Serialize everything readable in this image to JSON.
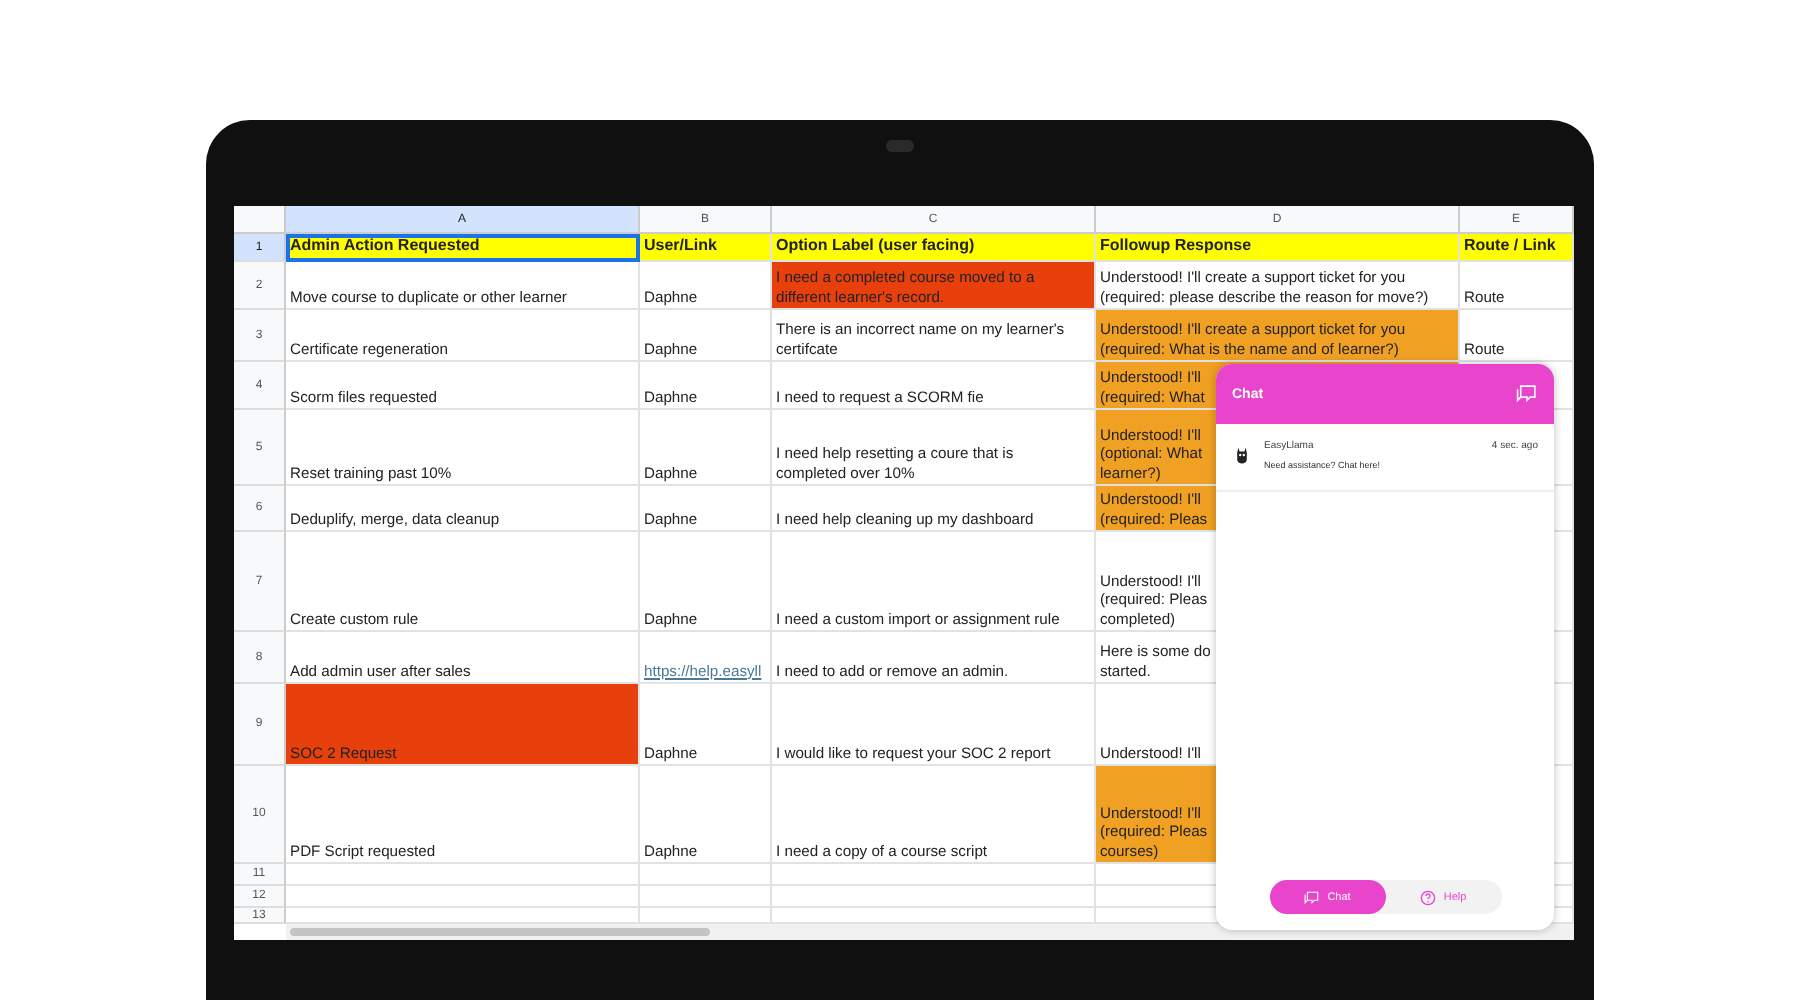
{
  "sheet": {
    "columns": [
      {
        "label": "A",
        "selected": true
      },
      {
        "label": "B",
        "selected": false
      },
      {
        "label": "C",
        "selected": false
      },
      {
        "label": "D",
        "selected": false
      },
      {
        "label": "E",
        "selected": false
      }
    ],
    "rows": [
      {
        "number": "1",
        "selected": true,
        "kind": "header",
        "cells": [
          {
            "lines": [
              "Admin Action Requested"
            ]
          },
          {
            "lines": [
              "User/Link"
            ]
          },
          {
            "lines": [
              "Option Label (user facing)"
            ]
          },
          {
            "lines": [
              "Followup Response"
            ]
          },
          {
            "lines": [
              "Route / Link"
            ]
          }
        ]
      },
      {
        "number": "2",
        "selected": false,
        "kind": "data",
        "cells": [
          {
            "lines": [
              "Move course to duplicate or other learner"
            ]
          },
          {
            "lines": [
              "Daphne"
            ]
          },
          {
            "lines": [
              "I need a completed course moved to a",
              "different learner's record."
            ],
            "color": "#e8400c"
          },
          {
            "lines": [
              "Understood! I'll create a support ticket for you",
              "(required: please describe the reason for move?)"
            ]
          },
          {
            "lines": [
              "Route"
            ]
          }
        ]
      },
      {
        "number": "3",
        "selected": false,
        "kind": "data",
        "cells": [
          {
            "lines": [
              "Certificate regeneration"
            ]
          },
          {
            "lines": [
              "Daphne"
            ]
          },
          {
            "lines": [
              "There is an incorrect name on my learner's",
              "certifcate"
            ]
          },
          {
            "lines": [
              "Understood! I'll create a support ticket for you",
              "(required: What is the name and of learner?)"
            ],
            "color": "#f0a023"
          },
          {
            "lines": [
              "Route"
            ]
          }
        ]
      },
      {
        "number": "4",
        "selected": false,
        "kind": "data",
        "cells": [
          {
            "lines": [
              "Scorm files requested"
            ]
          },
          {
            "lines": [
              "Daphne"
            ]
          },
          {
            "lines": [
              "I need to request a SCORM fie"
            ]
          },
          {
            "lines": [
              "Understood! I'll",
              "(required: What"
            ],
            "color": "#f0a023"
          }
        ]
      },
      {
        "number": "5",
        "selected": false,
        "kind": "data",
        "cells": [
          {
            "lines": [
              "Reset training past 10%"
            ]
          },
          {
            "lines": [
              "Daphne"
            ]
          },
          {
            "lines": [
              "I need help resetting a coure that is",
              "completed over 10%"
            ]
          },
          {
            "lines": [
              "Understood! I'll",
              "(optional: What",
              "learner?)"
            ],
            "color": "#f0a023"
          }
        ]
      },
      {
        "number": "6",
        "selected": false,
        "kind": "data",
        "cells": [
          {
            "lines": [
              "Deduplify, merge, data cleanup"
            ]
          },
          {
            "lines": [
              "Daphne"
            ]
          },
          {
            "lines": [
              "I need help cleaning up my dashboard"
            ]
          },
          {
            "lines": [
              "Understood! I'll",
              "(required: Pleas"
            ],
            "color": "#f0a023"
          }
        ]
      },
      {
        "number": "7",
        "selected": false,
        "kind": "data",
        "cells": [
          {
            "lines": [
              "Create custom rule"
            ]
          },
          {
            "lines": [
              "Daphne"
            ]
          },
          {
            "lines": [
              "I need a custom import or assignment rule"
            ]
          },
          {
            "lines": [
              "Understood! I'll",
              "(required: Pleas",
              "completed)"
            ]
          }
        ]
      },
      {
        "number": "8",
        "selected": false,
        "kind": "data",
        "cells": [
          {
            "lines": [
              "Add admin user after sales"
            ]
          },
          {
            "lines": [
              "https://help.easyll"
            ],
            "kind": "link"
          },
          {
            "lines": [
              "I need to add or remove an admin."
            ]
          },
          {
            "lines": [
              "Here is some do",
              "started."
            ]
          }
        ]
      },
      {
        "number": "9",
        "selected": false,
        "kind": "data",
        "cells": [
          {
            "lines": [
              "SOC 2 Request"
            ],
            "color": "#e8400c"
          },
          {
            "lines": [
              "Daphne"
            ]
          },
          {
            "lines": [
              "I would like to request your SOC 2 report"
            ]
          },
          {
            "lines": [
              "Understood! I'll"
            ]
          }
        ]
      },
      {
        "number": "10",
        "selected": false,
        "kind": "data",
        "cells": [
          {
            "lines": [
              "PDF Script requested"
            ]
          },
          {
            "lines": [
              "Daphne"
            ]
          },
          {
            "lines": [
              "I need a copy of a course script"
            ]
          },
          {
            "lines": [
              "Understood! I'll",
              "(required: Pleas",
              "courses)"
            ],
            "color": "#f0a023"
          }
        ]
      },
      {
        "number": "11",
        "selected": false,
        "kind": "data",
        "cells": []
      },
      {
        "number": "12",
        "selected": false,
        "kind": "data",
        "cells": []
      },
      {
        "number": "13",
        "selected": false,
        "kind": "data",
        "cells": []
      }
    ]
  },
  "chat": {
    "title": "Chat",
    "messages": [
      {
        "sender": "EasyLlama",
        "time": "4 sec. ago",
        "preview": "Need assistance? Chat here!"
      }
    ],
    "tabs": [
      {
        "label": "Chat",
        "selected": true
      },
      {
        "label": "Help",
        "selected": false
      }
    ]
  }
}
